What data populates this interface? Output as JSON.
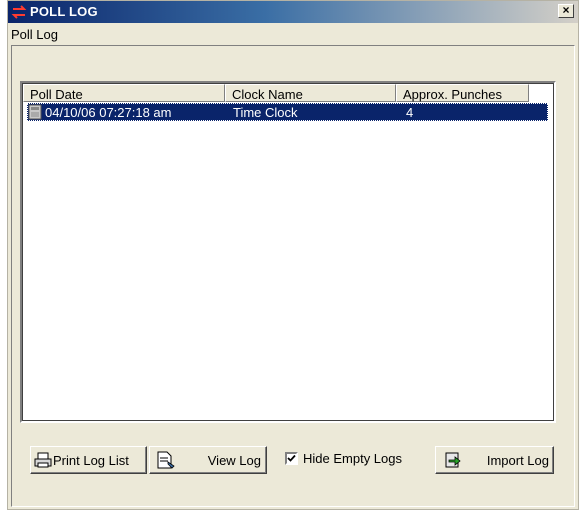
{
  "window": {
    "title": "POLL LOG",
    "subtitle": "Poll Log",
    "close_glyph": "×"
  },
  "list": {
    "columns": [
      "Poll Date",
      "Clock Name",
      "Approx. Punches"
    ],
    "rows": [
      {
        "date": "04/10/06 07:27:18 am",
        "clock": "Time Clock",
        "punches": "4",
        "selected": true
      }
    ]
  },
  "buttons": {
    "print": "Print Log List",
    "view": "View Log",
    "import": "Import Log"
  },
  "checkbox": {
    "label": "Hide Empty Logs",
    "checked": true
  },
  "icons": {
    "title": "transfer-arrows-icon",
    "row": "clock-log-icon",
    "print": "printer-icon",
    "view": "document-view-icon",
    "import": "import-arrow-icon"
  },
  "colors": {
    "title_start": "#0a246a",
    "selection": "#0a246a",
    "face": "#ece9d8"
  }
}
